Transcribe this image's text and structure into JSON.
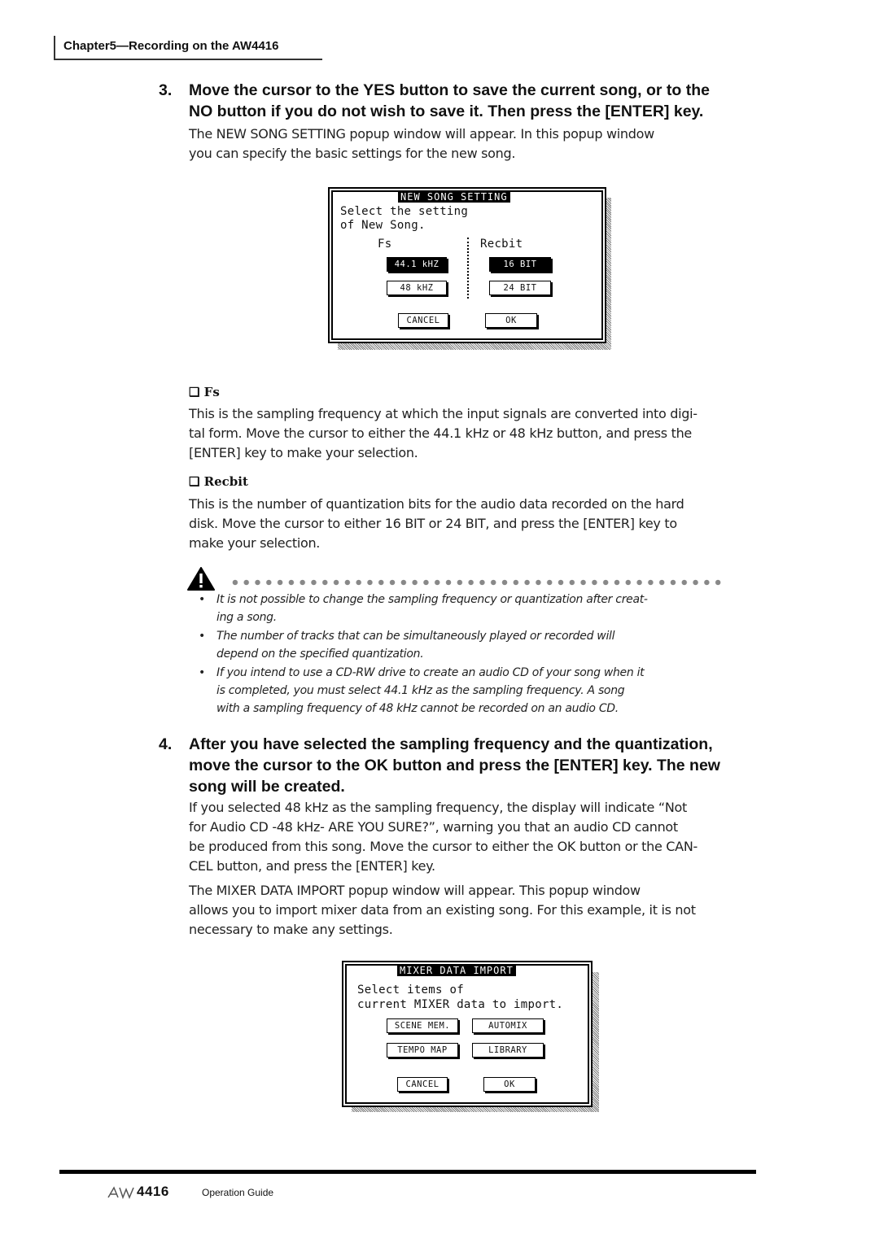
{
  "header": {
    "chapter": "Chapter5—Recording on the AW4416"
  },
  "step3": {
    "number": "3.",
    "heading_line1": "Move the cursor to the YES button to save the current song, or to the",
    "heading_line2": "NO button if you do not wish to save it. Then press the [ENTER] key.",
    "para_line1": "The NEW SONG SETTING popup window will appear. In this popup window",
    "para_line2": "you can specify the basic settings for the new song."
  },
  "new_song_popup": {
    "title": "NEW SONG SETTING",
    "prompt_line1": "Select the setting",
    "prompt_line2": "of New Song.",
    "fs_label": "Fs",
    "recbit_label": "Recbit",
    "fs_options": [
      {
        "label": "44.1 kHZ",
        "selected": true
      },
      {
        "label": "48 kHZ",
        "selected": false
      }
    ],
    "recbit_options": [
      {
        "label": "16 BIT",
        "selected": true
      },
      {
        "label": "24 BIT",
        "selected": false
      }
    ],
    "cancel": "CANCEL",
    "ok": "OK"
  },
  "fs_section": {
    "heading": "❑ Fs",
    "line1": "This is the sampling frequency at which the input signals are converted into digi-",
    "line2": "tal form. Move the cursor to either the 44.1 kHz or 48 kHz button, and press the",
    "line3": "[ENTER] key to make your selection."
  },
  "recbit_section": {
    "heading": "❑ Recbit",
    "line1": "This is the number of quantization bits for the audio data recorded on the hard",
    "line2": "disk. Move the cursor to either 16 BIT or 24 BIT, and press the [ENTER] key to",
    "line3": "make your selection."
  },
  "notes": [
    {
      "line1": "It is not possible to change the sampling frequency or quantization after creat-",
      "line2": "ing a song."
    },
    {
      "line1": "The number of tracks that can be simultaneously played or recorded will",
      "line2": "depend on the specified quantization."
    },
    {
      "line1": "If you intend to use a CD-RW drive to create an audio CD of your song when it",
      "line2": "is completed, you must select 44.1 kHz as the sampling frequency. A song",
      "line3": "with a sampling frequency of 48 kHz cannot be recorded on an audio CD."
    }
  ],
  "step4": {
    "number": "4.",
    "heading_line1": "After you have selected the sampling frequency and the quantization,",
    "heading_line2": "move the cursor to the OK button and press the [ENTER] key. The new",
    "heading_line3": "song will be created.",
    "para1_line1": "If you selected 48 kHz as the sampling frequency, the display will indicate “Not",
    "para1_line2": "for Audio CD -48 kHz- ARE YOU SURE?”, warning you that an audio CD cannot",
    "para1_line3": "be produced from this song. Move the cursor to either the OK button or the CAN-",
    "para1_line4": "CEL button, and press the [ENTER] key.",
    "para2_line1": "The MIXER DATA IMPORT popup window will appear. This popup window",
    "para2_line2": "allows you to import mixer data from an existing song. For this example, it is not",
    "para2_line3": "necessary to make any settings."
  },
  "mixer_popup": {
    "title": "MIXER DATA IMPORT",
    "prompt_line1": "Select items of",
    "prompt_line2": "current MIXER data to import.",
    "buttons": [
      "SCENE MEM.",
      "AUTOMIX",
      "TEMPO MAP",
      "LIBRARY"
    ],
    "cancel": "CANCEL",
    "ok": "OK"
  },
  "footer": {
    "logo": "AW4416",
    "text": "Operation Guide"
  }
}
